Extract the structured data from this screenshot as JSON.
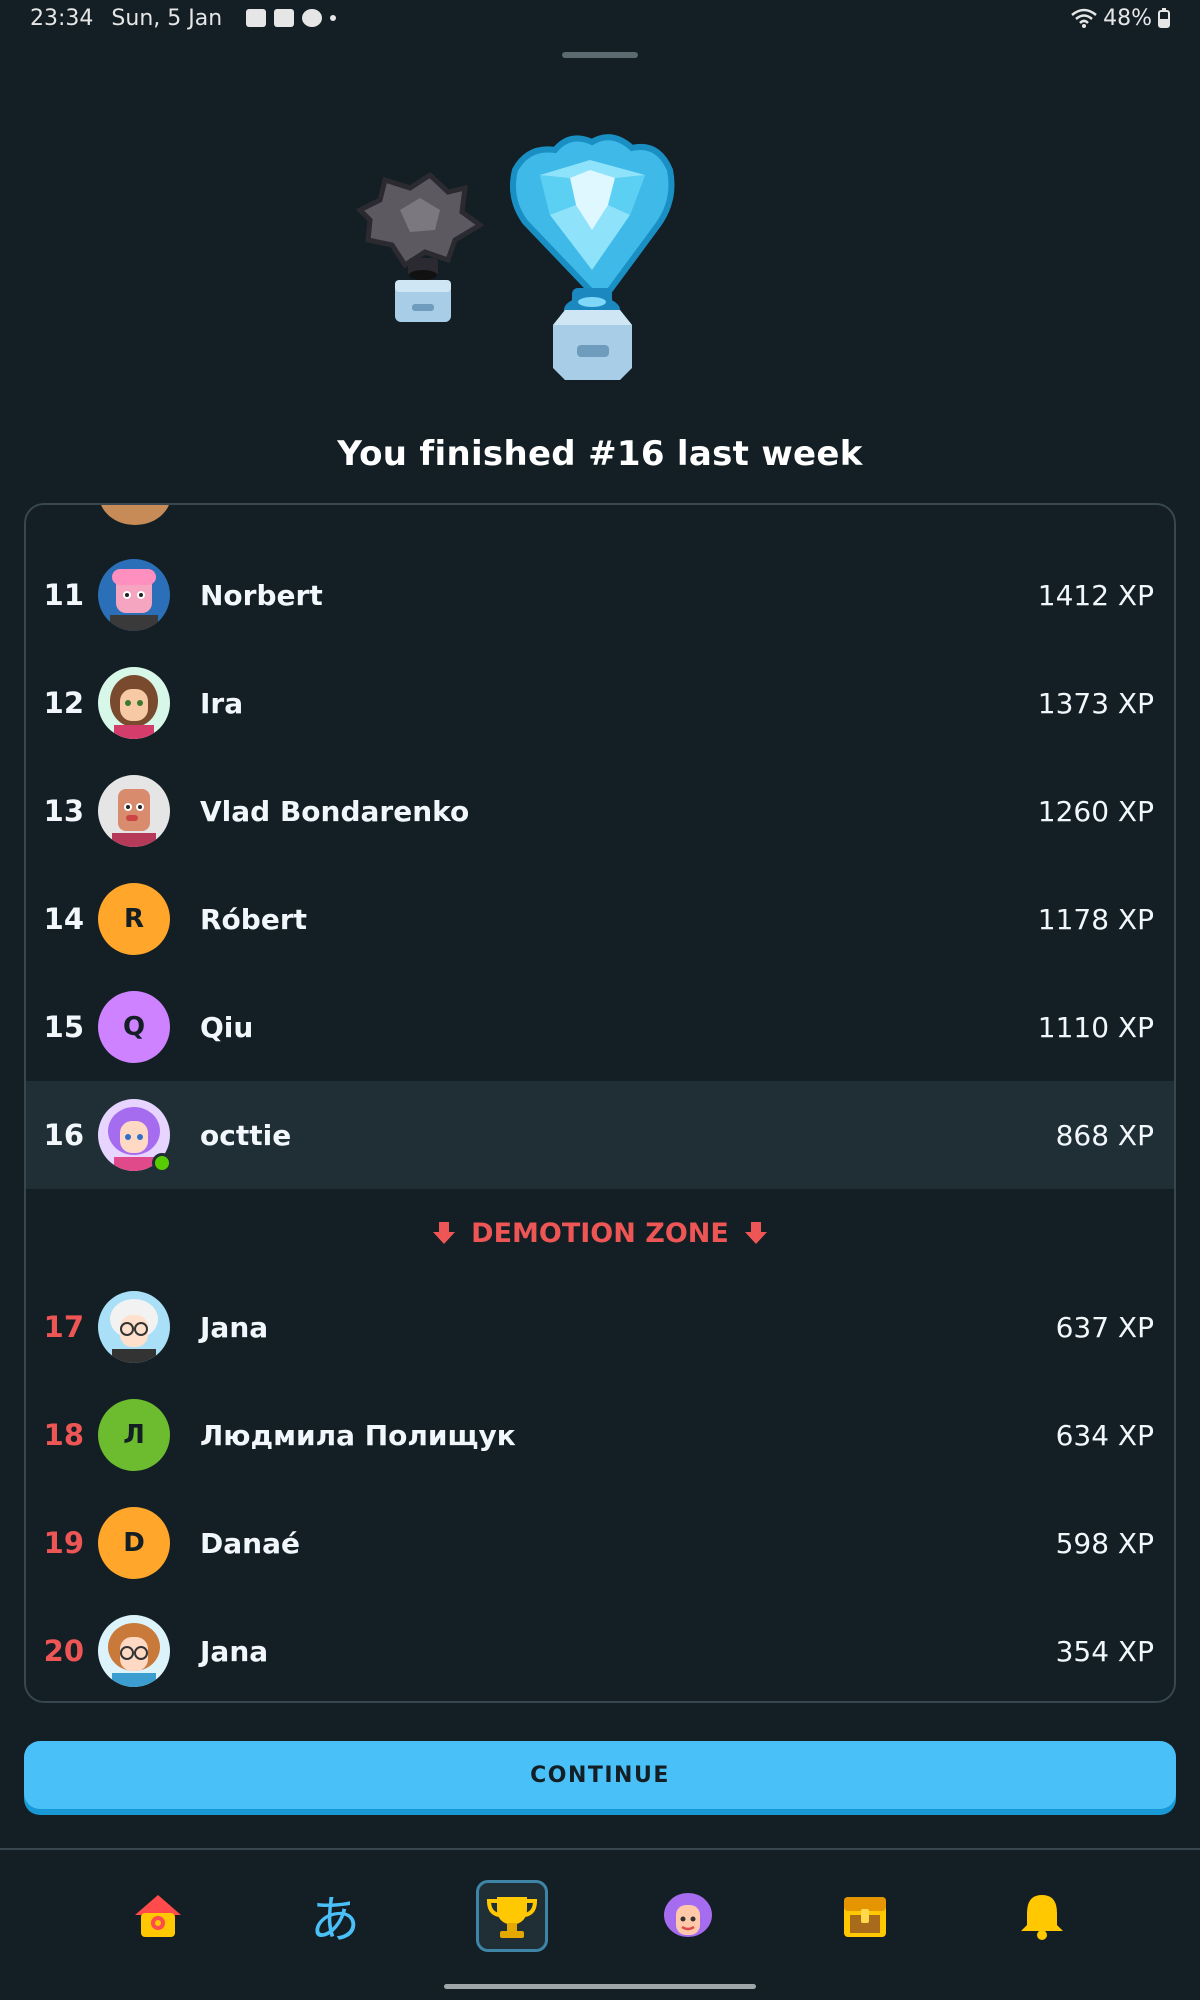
{
  "status_bar": {
    "time": "23:34",
    "date": "Sun, 5 Jan",
    "battery": "48%"
  },
  "headline": "You finished #16 last week",
  "leaderboard": {
    "rows": [
      {
        "rank": "11",
        "name": "Norbert",
        "xp": "1412 XP",
        "avatar_letter": ""
      },
      {
        "rank": "12",
        "name": "Ira",
        "xp": "1373 XP",
        "avatar_letter": ""
      },
      {
        "rank": "13",
        "name": "Vlad Bondarenko",
        "xp": "1260 XP",
        "avatar_letter": ""
      },
      {
        "rank": "14",
        "name": "Róbert",
        "xp": "1178 XP",
        "avatar_letter": "R"
      },
      {
        "rank": "15",
        "name": "Qiu",
        "xp": "1110 XP",
        "avatar_letter": "Q"
      },
      {
        "rank": "16",
        "name": "octtie",
        "xp": "868 XP",
        "avatar_letter": ""
      },
      {
        "rank": "17",
        "name": "Jana",
        "xp": "637 XP",
        "avatar_letter": ""
      },
      {
        "rank": "18",
        "name": "Людмила Полищук",
        "xp": "634 XP",
        "avatar_letter": "Л"
      },
      {
        "rank": "19",
        "name": "Danaé",
        "xp": "598 XP",
        "avatar_letter": "D"
      },
      {
        "rank": "20",
        "name": "Jana",
        "xp": "354 XP",
        "avatar_letter": ""
      }
    ],
    "demotion_label": "DEMOTION ZONE"
  },
  "continue_label": "CONTINUE",
  "nav": {
    "kana": "あ"
  },
  "colors": {
    "background": "#131f24",
    "accent_blue": "#49c0f8",
    "demotion_red": "#ee5555",
    "highlight_row": "#202f36"
  }
}
